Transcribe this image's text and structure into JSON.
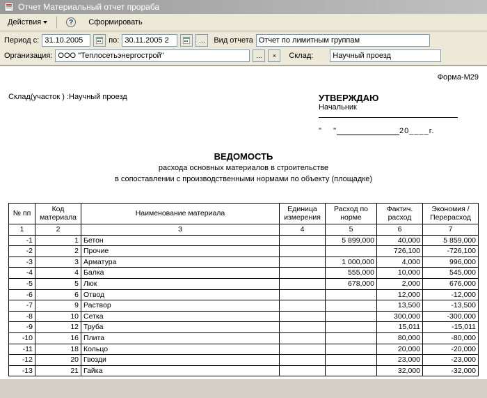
{
  "window": {
    "title": "Отчет  Материальный отчет прораба"
  },
  "toolbar": {
    "actions": "Действия",
    "form": "Сформировать"
  },
  "params": {
    "period_from_label": "Период с:",
    "period_from": "31.10.2005",
    "period_to_label": "по:",
    "period_to": "30.11.2005 2",
    "report_type_label": "Вид отчета",
    "report_type": "Отчет по лимитным группам",
    "org_label": "Организация:",
    "org": "ООО \"Теплосетьэнергострой\"",
    "sklad_label": "Склад:",
    "sklad": "Научный проезд"
  },
  "doc": {
    "form_no": "Форма-М29",
    "sklad_line": "Склад(участок ) :Научный проезд",
    "approve_title": "УТВЕРЖДАЮ",
    "approve_role": "Начальник",
    "year_suffix": "20____г.",
    "ved_title": "ВЕДОМОСТЬ",
    "ved_line1": "расхода основных материалов в строительстве",
    "ved_line2": "в сопоставлении с производственными нормами по объекту (площадке)"
  },
  "chart_data": {
    "type": "table",
    "columns": [
      "№ пп",
      "Код материала",
      "Наименование материала",
      "Единица измерения",
      "Расход по норме",
      "Фактич. расход",
      "Экономия / Перерасход"
    ],
    "col_numbers": [
      "1",
      "2",
      "3",
      "4",
      "5",
      "6",
      "7"
    ],
    "rows": [
      {
        "n": "-1",
        "code": "1",
        "name": "Бетон",
        "unit": "",
        "norm": "5 899,000",
        "fact": "40,000",
        "diff": "5 859,000"
      },
      {
        "n": "-2",
        "code": "2",
        "name": "Прочие",
        "unit": "",
        "norm": "",
        "fact": "726,100",
        "diff": "-726,100"
      },
      {
        "n": "-3",
        "code": "3",
        "name": "Арматура",
        "unit": "",
        "norm": "1 000,000",
        "fact": "4,000",
        "diff": "996,000"
      },
      {
        "n": "-4",
        "code": "4",
        "name": "Балка",
        "unit": "",
        "norm": "555,000",
        "fact": "10,000",
        "diff": "545,000"
      },
      {
        "n": "-5",
        "code": "5",
        "name": "Люк",
        "unit": "",
        "norm": "678,000",
        "fact": "2,000",
        "diff": "676,000"
      },
      {
        "n": "-6",
        "code": "6",
        "name": "Отвод",
        "unit": "",
        "norm": "",
        "fact": "12,000",
        "diff": "-12,000"
      },
      {
        "n": "-7",
        "code": "9",
        "name": "Раствор",
        "unit": "",
        "norm": "",
        "fact": "13,500",
        "diff": "-13,500"
      },
      {
        "n": "-8",
        "code": "10",
        "name": "Сетка",
        "unit": "",
        "norm": "",
        "fact": "300,000",
        "diff": "-300,000"
      },
      {
        "n": "-9",
        "code": "12",
        "name": "Труба",
        "unit": "",
        "norm": "",
        "fact": "15,011",
        "diff": "-15,011"
      },
      {
        "n": "-10",
        "code": "16",
        "name": "Плита",
        "unit": "",
        "norm": "",
        "fact": "80,000",
        "diff": "-80,000"
      },
      {
        "n": "-11",
        "code": "18",
        "name": "Кольцо",
        "unit": "",
        "norm": "",
        "fact": "20,000",
        "diff": "-20,000"
      },
      {
        "n": "-12",
        "code": "20",
        "name": "Гвозди",
        "unit": "",
        "norm": "",
        "fact": "23,000",
        "diff": "-23,000"
      },
      {
        "n": "-13",
        "code": "21",
        "name": "Гайка",
        "unit": "",
        "norm": "",
        "fact": "32,000",
        "diff": "-32,000"
      }
    ]
  }
}
